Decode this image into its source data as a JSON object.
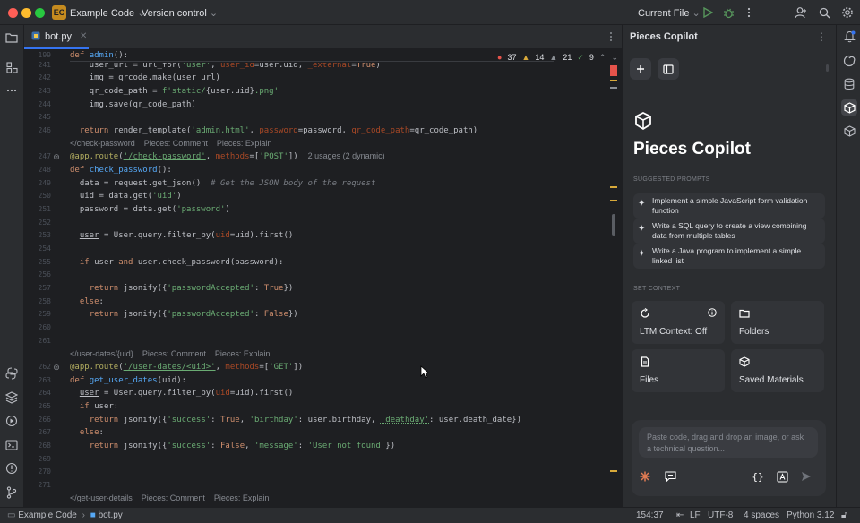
{
  "titlebar": {
    "project_badge": "EC",
    "project_name": "Example Code",
    "vcs": "Version control",
    "run_config": "Current File"
  },
  "editor": {
    "tab_label": "bot.py",
    "inspections": {
      "errors": "37",
      "warnings": "14",
      "weak_warnings": "21",
      "ok": "9"
    },
    "hints": {
      "check_password": [
        "</check-password",
        "Pieces: Comment",
        "Pieces: Explain"
      ],
      "user_dates": [
        "</user-dates/{uid}",
        "Pieces: Comment",
        "Pieces: Explain"
      ],
      "user_details": [
        "</get-user-details",
        "Pieces: Comment",
        "Pieces: Explain"
      ],
      "usages": "2 usages (2 dynamic)"
    },
    "line_numbers": [
      "199",
      "241",
      "242",
      "243",
      "244",
      "245",
      "246",
      "247",
      "248",
      "249",
      "250",
      "251",
      "252",
      "253",
      "254",
      "255",
      "256",
      "257",
      "258",
      "259",
      "260",
      "261",
      "262",
      "263",
      "264",
      "265",
      "266",
      "267",
      "268",
      "269",
      "270",
      "271"
    ]
  },
  "copilot": {
    "panel_title": "Pieces Copilot",
    "heading": "Pieces Copilot",
    "suggested_label": "SUGGESTED PROMPTS",
    "prompts": [
      "Implement a simple JavaScript form validation function",
      "Write a SQL query to create a view combining data from multiple tables",
      "Write a Java program to implement a simple linked list"
    ],
    "context_label": "SET CONTEXT",
    "context_cards": [
      "LTM Context: Off",
      "Folders",
      "Files",
      "Saved Materials"
    ],
    "chat_placeholder": "Paste code, drag and drop an image, or ask a technical question..."
  },
  "statusbar": {
    "crumb_project": "Example Code",
    "crumb_file": "bot.py",
    "position": "154:37",
    "line_sep": "LF",
    "encoding": "UTF-8",
    "indent": "4 spaces",
    "interpreter": "Python 3.12"
  },
  "colors": {
    "accent": "#3574f0",
    "background": "#1e1f22",
    "panel": "#2b2d30",
    "badge": "#c58b1f",
    "error": "#e5534b"
  }
}
